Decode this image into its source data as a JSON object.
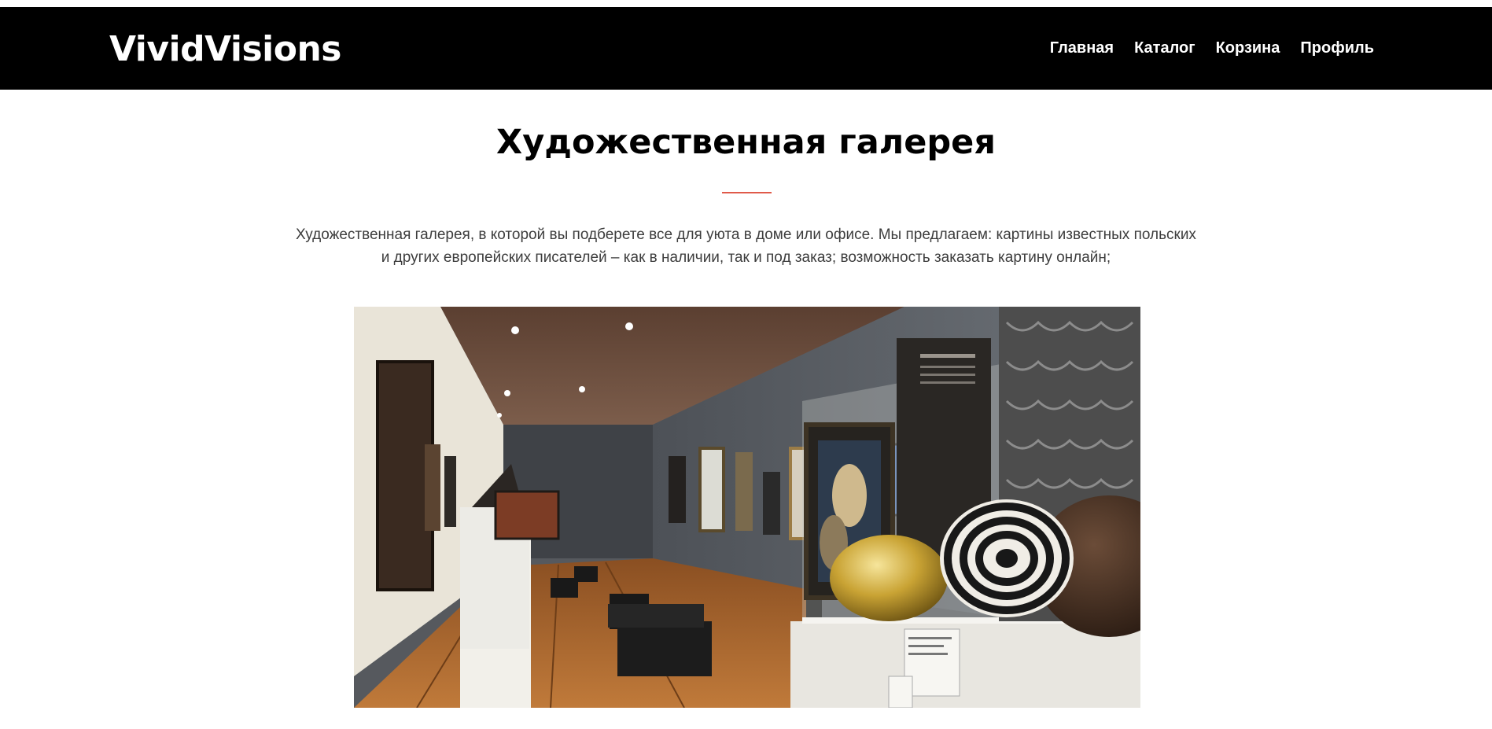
{
  "brand": {
    "name": "VividVisions"
  },
  "nav": {
    "items": [
      {
        "label": "Главная"
      },
      {
        "label": "Каталог"
      },
      {
        "label": "Корзина"
      },
      {
        "label": "Профиль"
      }
    ]
  },
  "page": {
    "title": "Художественная галерея",
    "description": "Художественная галерея, в которой вы подберете все для уюта в доме или офисе. Мы предлагаем: картины известных польских и других европейских писателей – как в наличии, так и под заказ; возможность заказать картину онлайн;"
  },
  "colors": {
    "navbar_bg": "#000000",
    "accent_divider": "#e05a4a",
    "text_body": "#3d3d3d"
  },
  "hero_image": {
    "subject": "gallery-interior-photo"
  }
}
